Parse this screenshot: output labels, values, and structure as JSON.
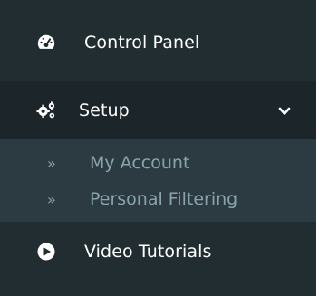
{
  "sidebar": {
    "items": [
      {
        "label": "Control Panel",
        "icon": "dashboard-icon"
      },
      {
        "label": "Setup",
        "icon": "cogs-icon",
        "expanded": true
      },
      {
        "label": "Video Tutorials",
        "icon": "play-circle-icon"
      }
    ],
    "setup_submenu": [
      {
        "arrow": "»",
        "label": "My Account"
      },
      {
        "arrow": "»",
        "label": "Personal Filtering"
      }
    ]
  },
  "colors": {
    "sidebar_bg": "#222d32",
    "active_bg": "#1c2529",
    "submenu_bg": "#2c3b41",
    "text_primary": "#ffffff",
    "text_submenu": "#8aa4af"
  }
}
